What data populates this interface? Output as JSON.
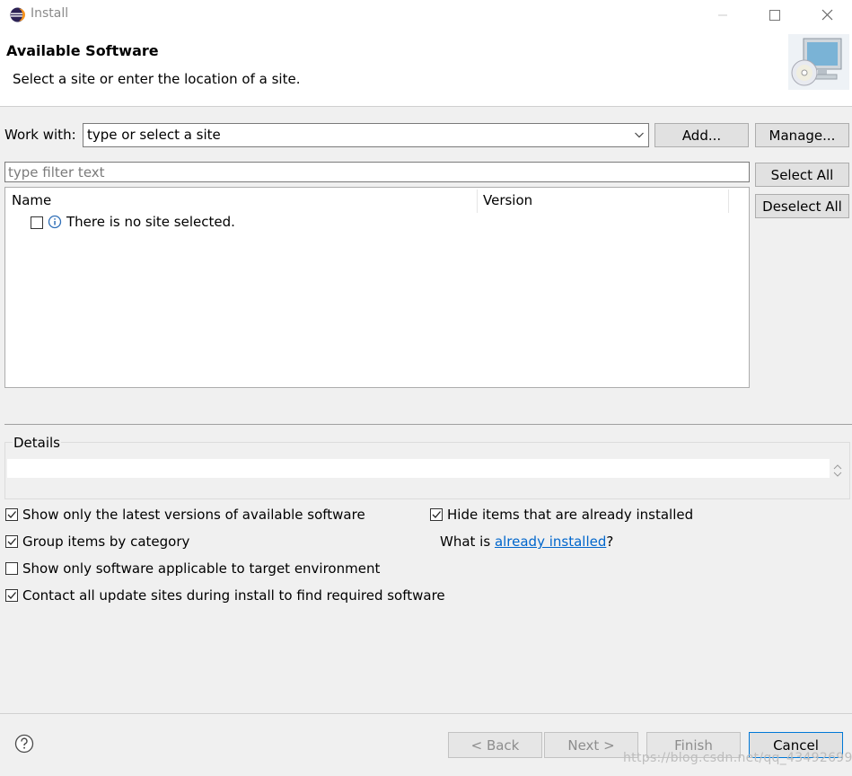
{
  "window": {
    "title": "Install"
  },
  "header": {
    "heading": "Available Software",
    "description": "Select a site or enter the location of a site."
  },
  "work_with": {
    "label": "Work with:",
    "value": "type or select a site",
    "add_label": "Add...",
    "manage_label": "Manage..."
  },
  "filter": {
    "placeholder": "type filter text"
  },
  "side_buttons": {
    "select_all": "Select All",
    "deselect_all": "Deselect All"
  },
  "table": {
    "columns": [
      "Name",
      "Version"
    ],
    "rows": [
      {
        "name": "There is no site selected.",
        "version": "",
        "checked": false
      }
    ]
  },
  "details": {
    "label": "Details",
    "text": ""
  },
  "options": {
    "latest_versions": {
      "label": "Show only the latest versions of available software",
      "checked": true
    },
    "group_by_category": {
      "label": "Group items by category",
      "checked": true
    },
    "target_env": {
      "label": "Show only software applicable to target environment",
      "checked": false
    },
    "contact_sites": {
      "label": "Contact all update sites during install to find required software",
      "checked": true
    },
    "hide_installed": {
      "label": "Hide items that are already installed",
      "checked": true
    },
    "what_is": {
      "prefix": "What is ",
      "link": "already installed",
      "suffix": "?"
    }
  },
  "footer": {
    "back_label": "< Back",
    "next_label": "Next >",
    "finish_label": "Finish",
    "cancel_label": "Cancel",
    "watermark": "https://blog.csdn.net/qq_43492699"
  },
  "colors": {
    "link": "#0066cc",
    "button_face": "#e1e1e1",
    "dialog_bg": "#f0f0f0"
  },
  "icons": [
    "eclipse-icon",
    "minimize-icon",
    "maximize-icon",
    "close-icon",
    "monitor-cd-icon",
    "dropdown-arrow-icon",
    "info-icon",
    "spinner-icon",
    "help-icon"
  ]
}
